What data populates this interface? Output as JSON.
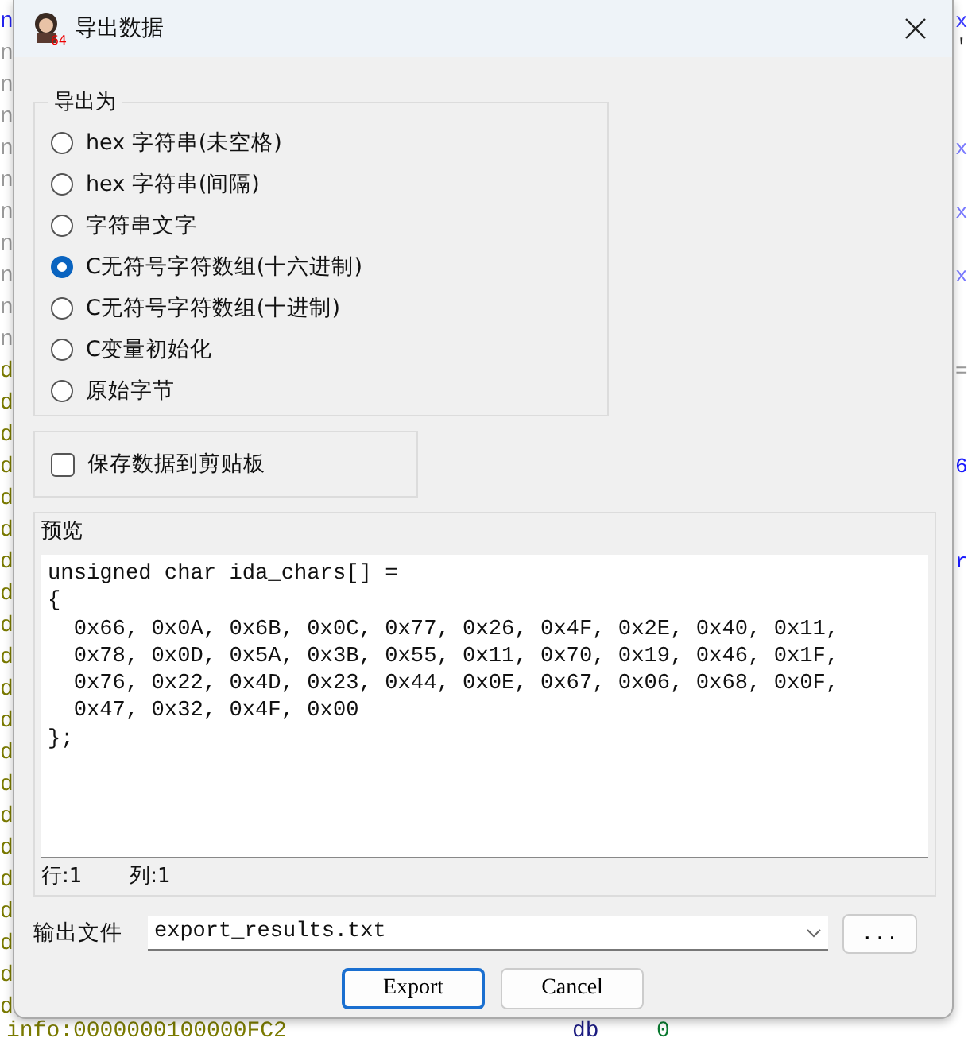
{
  "background": {
    "left_marks": [
      "n",
      "n",
      "n",
      "n",
      "n",
      "n",
      "n",
      "n",
      "n",
      "n",
      "n",
      "d",
      "d",
      "d",
      "d",
      "d",
      "d",
      "d",
      "d",
      "d",
      "d",
      "d",
      "d",
      "d",
      "d",
      "d",
      "d",
      "d",
      "d",
      "d",
      "d",
      "d"
    ],
    "right_marks": [
      "x",
      "'",
      "x",
      "x",
      "x",
      "=",
      "6",
      "r"
    ],
    "bottom_line": [
      "info:0000000100000FC2",
      "db",
      "0"
    ]
  },
  "window": {
    "title": "导出数据",
    "icon_badge": "64"
  },
  "export_as": {
    "label": "导出为",
    "options": [
      {
        "label": "hex 字符串(未空格)",
        "selected": false
      },
      {
        "label": "hex 字符串(间隔)",
        "selected": false
      },
      {
        "label": "字符串文字",
        "selected": false
      },
      {
        "label": "C无符号字符数组(十六进制)",
        "selected": true
      },
      {
        "label": "C无符号字符数组(十进制)",
        "selected": false
      },
      {
        "label": "C变量初始化",
        "selected": false
      },
      {
        "label": "原始字节",
        "selected": false
      }
    ]
  },
  "save_to_clipboard": {
    "label": "保存数据到剪贴板",
    "checked": false
  },
  "preview": {
    "label": "预览",
    "lines": [
      "unsigned char ida_chars[] =",
      "{",
      "  0x66, 0x0A, 0x6B, 0x0C, 0x77, 0x26, 0x4F, 0x2E, 0x40, 0x11,",
      "  0x78, 0x0D, 0x5A, 0x3B, 0x55, 0x11, 0x70, 0x19, 0x46, 0x1F,",
      "  0x76, 0x22, 0x4D, 0x23, 0x44, 0x0E, 0x67, 0x06, 0x68, 0x0F,",
      "  0x47, 0x32, 0x4F, 0x00",
      "};"
    ],
    "row": "行:1",
    "column": "列:1"
  },
  "output_file": {
    "label": "输出文件",
    "value": "export_results.txt",
    "browse": "..."
  },
  "buttons": [
    {
      "label": "Export",
      "focused": true
    },
    {
      "label": "Cancel",
      "focused": false
    }
  ]
}
